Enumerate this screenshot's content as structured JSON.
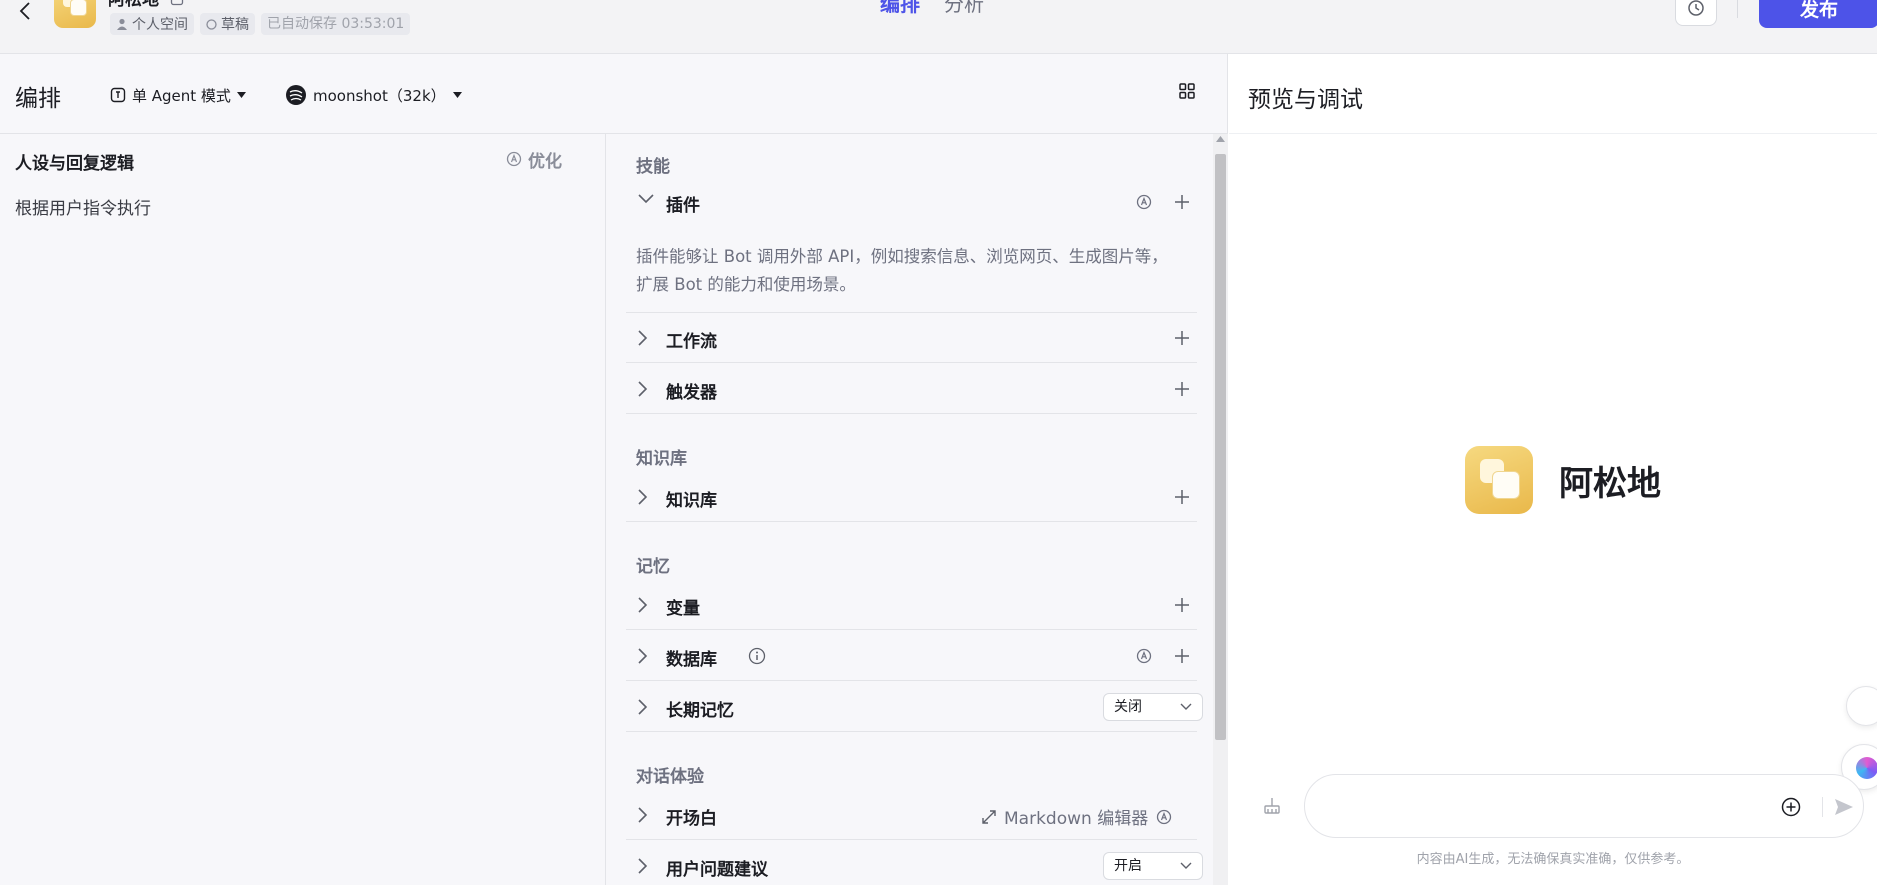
{
  "header": {
    "bot_name": "阿松地",
    "space": "个人空间",
    "status": "草稿",
    "autosave": "已自动保存 03:53:01",
    "tabs": [
      {
        "label": "编排",
        "active": true
      },
      {
        "label": "分析",
        "active": false
      }
    ],
    "publish_label": "发布",
    "accent_color": "#4d53e8"
  },
  "arrange": {
    "title": "编排",
    "mode_label": "单 Agent 模式",
    "model_label": "moonshot（32k）",
    "persona": {
      "title": "人设与回复逻辑",
      "optimize_label": "优化",
      "content": "根据用户指令执行"
    },
    "skills": {
      "section_skill": "技能",
      "plugin_title": "插件",
      "plugin_desc": "插件能够让 Bot 调用外部 API，例如搜索信息、浏览网页、生成图片等，扩展 Bot 的能力和使用场景。",
      "workflow_title": "工作流",
      "trigger_title": "触发器",
      "section_knowledge": "知识库",
      "knowledge_title": "知识库",
      "section_memory": "记忆",
      "variable_title": "变量",
      "database_title": "数据库",
      "longterm_title": "长期记忆",
      "longterm_value": "关闭",
      "section_dialog": "对话体验",
      "opening_title": "开场白",
      "markdown_label": "Markdown 编辑器",
      "suggest_title": "用户问题建议",
      "suggest_value": "开启"
    }
  },
  "preview": {
    "title": "预览与调试",
    "bot_name": "阿松地",
    "input_placeholder": "",
    "disclaimer": "内容由AI生成，无法确保真实准确，仅供参考。"
  }
}
